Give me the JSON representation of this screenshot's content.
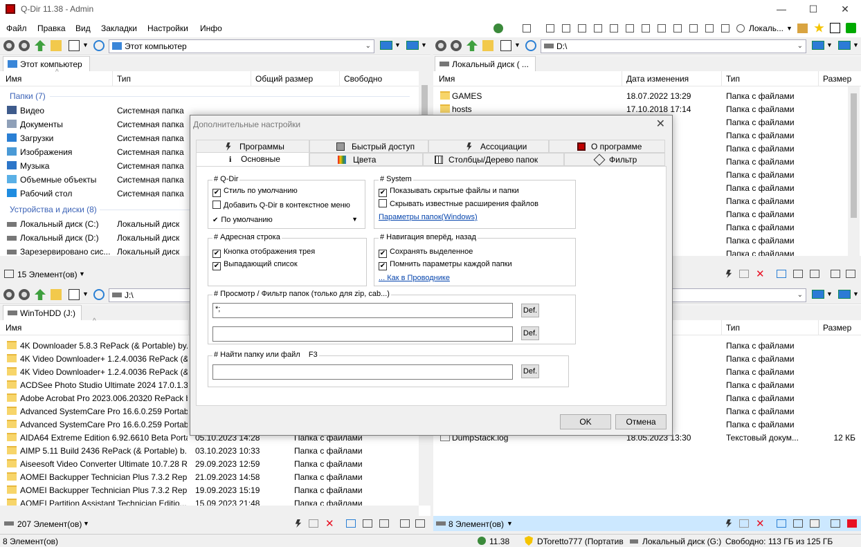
{
  "window": {
    "title": "Q-Dir 11.38 - Admin",
    "minimize": "—",
    "maximize": "☐",
    "close": "✕"
  },
  "menu": [
    "Файл",
    "Правка",
    "Вид",
    "Закладки",
    "Настройки",
    "Инфо"
  ],
  "menu_right": {
    "view_label": "Локаль...",
    "view_dd": "▼"
  },
  "top_left": {
    "address": "Этот компьютер",
    "tab": "Этот компьютер",
    "columns": [
      "Имя",
      "Тип",
      "Общий размер",
      "Свободно"
    ],
    "group_folders": "Папки (7)",
    "folders": [
      {
        "name": "Видео",
        "type": "Системная папка",
        "icon": "video-folder-icon",
        "color": "#3e5b8c"
      },
      {
        "name": "Документы",
        "type": "Системная папка",
        "icon": "documents-icon",
        "color": "#8fa0b8"
      },
      {
        "name": "Загрузки",
        "type": "Системная папка",
        "icon": "downloads-icon",
        "color": "#2a7fd4"
      },
      {
        "name": "Изображения",
        "type": "Системная папка",
        "icon": "images-icon",
        "color": "#4a9ad6"
      },
      {
        "name": "Музыка",
        "type": "Системная папка",
        "icon": "music-icon",
        "color": "#2c76c9"
      },
      {
        "name": "Объемные объекты",
        "type": "Системная папка",
        "icon": "3d-objects-icon",
        "color": "#5ab0e6"
      },
      {
        "name": "Рабочий стол",
        "type": "Системная папка",
        "icon": "desktop-icon",
        "color": "#1f8ce0"
      }
    ],
    "group_drives": "Устройства и диски (8)",
    "drives": [
      {
        "name": "Локальный диск (C:)",
        "type": "Локальный диск"
      },
      {
        "name": "Локальный диск (D:)",
        "type": "Локальный диск"
      },
      {
        "name": "Зарезервировано сис...",
        "type": "Локальный диск"
      }
    ],
    "status": "15 Элемент(ов)"
  },
  "top_right": {
    "address": "D:\\",
    "tab": "Локальный диск ( ...",
    "columns": [
      "Имя",
      "Дата изменения",
      "Тип",
      "Размер"
    ],
    "rows": [
      {
        "name": "GAMES",
        "date": "18.07.2022 13:29",
        "type": "Папка с файлами"
      },
      {
        "name": "hosts",
        "date": "17.10.2018 17:14",
        "type": "Папка с файлами"
      },
      {
        "name": "",
        "date": "0:17",
        "type": "Папка с файлами"
      },
      {
        "name": "",
        "date": "9:29",
        "type": "Папка с файлами"
      },
      {
        "name": "",
        "date": "2:38",
        "type": "Папка с файлами"
      },
      {
        "name": "",
        "date": "3:48",
        "type": "Папка с файлами"
      },
      {
        "name": "",
        "date": "3:24",
        "type": "Папка с файлами"
      },
      {
        "name": "",
        "date": "0:30",
        "type": "Папка с файлами"
      },
      {
        "name": "",
        "date": "4:08",
        "type": "Папка с файлами"
      },
      {
        "name": "",
        "date": "0:18",
        "type": "Папка с файлами"
      },
      {
        "name": "",
        "date": "0:48",
        "type": "Папка с файлами"
      },
      {
        "name": "",
        "date": "5:45",
        "type": "Папка с файлами"
      },
      {
        "name": "",
        "date": "2:53",
        "type": "Папка с файлами"
      }
    ]
  },
  "bottom_left": {
    "address": "J:\\",
    "tab": "WinToHDD (J:)",
    "columns": [
      "Имя"
    ],
    "rows": [
      {
        "name": "4K Downloader 5.8.3 RePack (& Portable) by...",
        "date": "",
        "type": ""
      },
      {
        "name": "4K Video Downloader+ 1.2.4.0036 RePack (&...",
        "date": "",
        "type": ""
      },
      {
        "name": "4K Video Downloader+ 1.2.4.0036 RePack (&...",
        "date": "",
        "type": ""
      },
      {
        "name": "ACDSee Photo Studio Ultimate 2024 17.0.1.3...",
        "date": "",
        "type": ""
      },
      {
        "name": "Adobe Acrobat Pro 2023.006.20320 RePack b...",
        "date": "",
        "type": ""
      },
      {
        "name": "Advanced SystemCare Pro 16.6.0.259 Portab...",
        "date": "",
        "type": ""
      },
      {
        "name": "Advanced SystemCare Pro 16.6.0.259 Portab...",
        "date": "",
        "type": ""
      },
      {
        "name": "AIDA64 Extreme Edition 6.92.6610 Beta Porta...",
        "date": "05.10.2023 14:28",
        "type": "Папка с файлами"
      },
      {
        "name": "AIMP 5.11 Build 2436 RePack (& Portable) b...",
        "date": "03.10.2023 10:33",
        "type": "Папка с файлами"
      },
      {
        "name": "Aiseesoft Video Converter Ultimate 10.7.28 R...",
        "date": "29.09.2023 12:59",
        "type": "Папка с файлами"
      },
      {
        "name": "AOMEI Backupper Technician Plus 7.3.2 Rep...",
        "date": "21.09.2023 14:58",
        "type": "Папка с файлами"
      },
      {
        "name": "AOMEI Backupper Technician Plus 7.3.2 Rep...",
        "date": "19.09.2023 15:19",
        "type": "Папка с файлами"
      },
      {
        "name": "AOMEI Partition Assistant Technician Editio...",
        "date": "15.09.2023 21:48",
        "type": "Папка с файлами"
      }
    ],
    "status": "207 Элемент(ов)"
  },
  "bottom_right": {
    "columns": [
      "Тип",
      "Размер"
    ],
    "rows": [
      {
        "name": "",
        "date": "5:13",
        "type": "Папка с файлами",
        "size": ""
      },
      {
        "name": "",
        "date": "9:29",
        "type": "Папка с файлами",
        "size": ""
      },
      {
        "name": "",
        "date": "5:13",
        "type": "Папка с файлами",
        "size": ""
      },
      {
        "name": "",
        "date": "24",
        "type": "Папка с файлами",
        "size": ""
      },
      {
        "name": "",
        "date": "3:39",
        "type": "Папка с файлами",
        "size": ""
      },
      {
        "name": "",
        "date": "3:36",
        "type": "Папка с файлами",
        "size": ""
      },
      {
        "name": "",
        "date": "42",
        "type": "Папка с файлами",
        "size": ""
      },
      {
        "name": "DumpStack.log",
        "date": "18.05.2023 13:30",
        "type": "Текстовый докум...",
        "size": "12 КБ"
      }
    ],
    "status": "8 Элемент(ов)"
  },
  "dialog": {
    "title": "Дополнительные настройки",
    "close": "✕",
    "tabs_row1": [
      "Программы",
      "Быстрый доступ",
      "Ассоциации",
      "О программе"
    ],
    "tabs_row2": [
      "Основные",
      "Цвета",
      "Столбцы/Дерево папок",
      "Фильтр"
    ],
    "tab_active_glyph": "i",
    "qdir": {
      "title": "# Q-Dir",
      "default_style": "Стиль по умолчанию",
      "context_menu": "Добавить Q-Dir в контекстное меню",
      "default_label": "По умолчанию",
      "default_dd": "▼"
    },
    "system": {
      "title": "# System",
      "show_hidden": "Показывать скрытые файлы и папки",
      "hide_ext": "Скрывать известные расширения файлов",
      "folder_options": "Параметры папок(Windows)"
    },
    "address": {
      "title": "# Адресная строка",
      "tray_button": "Кнопка отображения трея",
      "dropdown_list": "Выпадающий список"
    },
    "nav": {
      "title": "# Навигация вперёд, назад",
      "save_selected": "Сохранять выделенное",
      "remember_params": "Помнить параметры каждой папки",
      "like_explorer": "... Как в Проводнике"
    },
    "filter": {
      "title": "# Просмотр / Фильтр папок (только для zip, cab...)",
      "value1": "*;",
      "value2": "",
      "def": "Def."
    },
    "find": {
      "title": "# Найти папку или файл",
      "hotkey": "F3",
      "value": "",
      "def": "Def."
    },
    "ok": "OK",
    "cancel": "Отмена",
    "check": "✔"
  },
  "taskbar": {
    "items": "8 Элемент(ов)",
    "version": "11.38",
    "user": "DToretto777 (Портатив",
    "drive": "Локальный диск (G:)",
    "free": "Свободно: 113 ГБ из 125 ГБ"
  },
  "colors": {
    "accent": "#3c63b7",
    "folder": "#f7d56a",
    "selection": "#cce8ff",
    "red": "#e81123"
  }
}
